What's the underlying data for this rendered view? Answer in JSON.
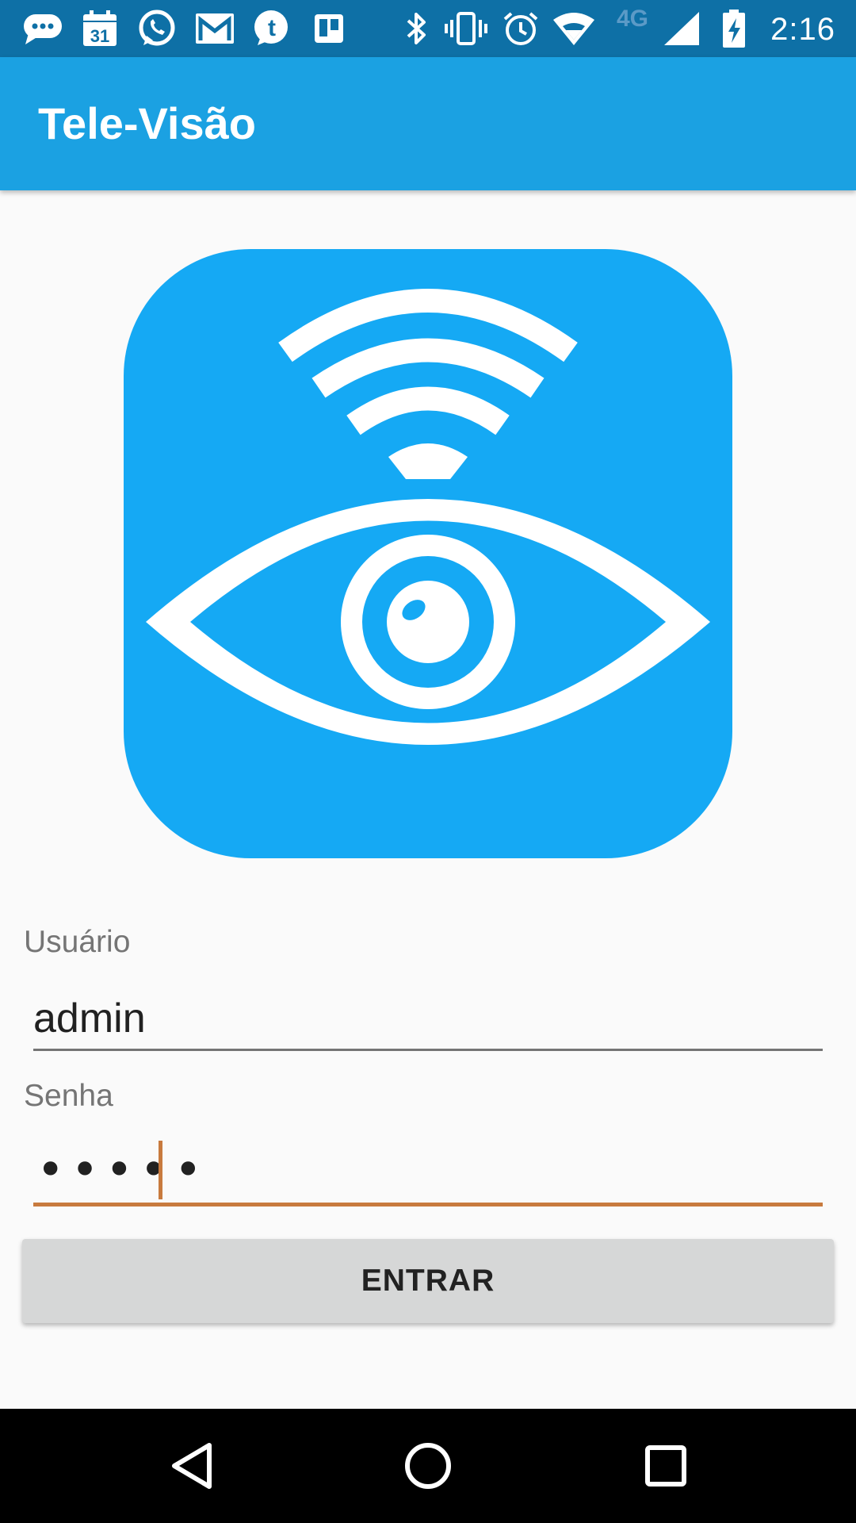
{
  "status_bar": {
    "time": "2:16",
    "network_type": "4G",
    "calendar_day": "31",
    "icons": [
      "messages-icon",
      "calendar-icon",
      "whatsapp-icon",
      "gmail-icon",
      "tumblr-icon",
      "trello-icon",
      "bluetooth-icon",
      "vibrate-icon",
      "alarm-icon",
      "wifi-icon",
      "signal-icon",
      "battery-charging-icon"
    ]
  },
  "app_bar": {
    "title": "Tele-Visão"
  },
  "logo": {
    "icon": "wifi-eye-icon",
    "color": "#15a9f4"
  },
  "form": {
    "username_label": "Usuário",
    "username_value": "admin",
    "password_label": "Senha",
    "password_masked": "•••••",
    "submit_label": "ENTRAR"
  },
  "nav_bar": {
    "icons": [
      "back-icon",
      "home-icon",
      "recents-icon"
    ]
  },
  "colors": {
    "status_bar": "#0e70a6",
    "app_bar": "#1ba1e2",
    "focus_accent": "#c87a3e",
    "button": "#d6d7d7"
  }
}
